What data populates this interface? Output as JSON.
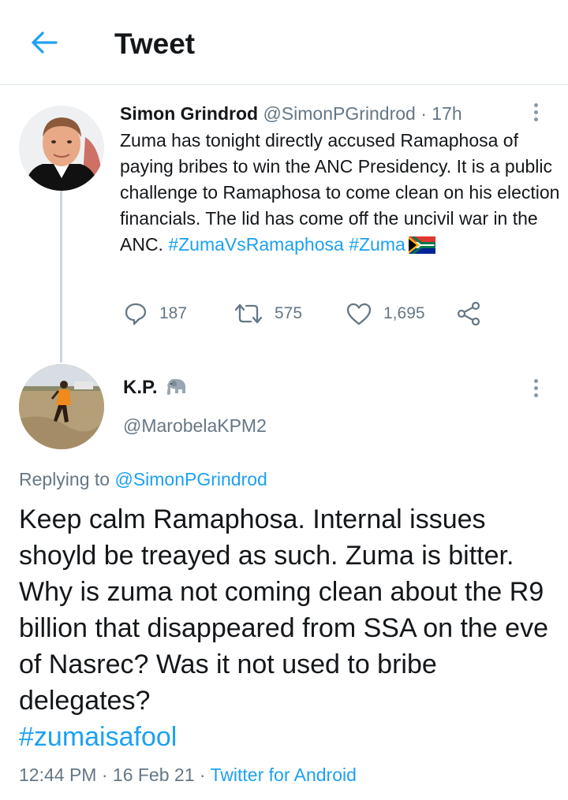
{
  "header": {
    "title": "Tweet"
  },
  "original_tweet": {
    "display_name": "Simon Grindrod",
    "handle": "@SimonPGrindrod",
    "separator": " · ",
    "time_ago": "17h",
    "text": "Zuma has tonight directly accused Ramaphosa of paying bribes to win the ANC Presidency. It is a public challenge to Ramaphosa to come clean on his election financials. The lid has come off the uncivil war in the ANC.",
    "hashtag_1": "#ZumaVsRamaphosa",
    "hashtag_2": "#Zuma",
    "flag_icon": "south-africa-flag-emoji",
    "stats": {
      "replies": "187",
      "retweets": "575",
      "likes": "1,695"
    }
  },
  "reply_tweet": {
    "display_name": "K.P.",
    "name_emoji": "elephant-emoji",
    "handle": "@MarobelaKPM2",
    "replying_prefix": "Replying to ",
    "replying_to": "@SimonPGrindrod",
    "text": "Keep calm Ramaphosa. Internal issues shoyld be treayed as such. Zuma is bitter. Why is zuma not coming clean about the R9 billion that disappeared from SSA on the eve of Nasrec? Was it not used to bribe delegates?",
    "hashtag": "#zumaisafool",
    "time": "12:44 PM",
    "sep": " · ",
    "date": "16 Feb 21",
    "sep2": " · ",
    "source": "Twitter for Android"
  },
  "colors": {
    "accent": "#1da1f2",
    "text": "#14171a",
    "muted": "#657786",
    "divider": "#e1e8ed"
  }
}
